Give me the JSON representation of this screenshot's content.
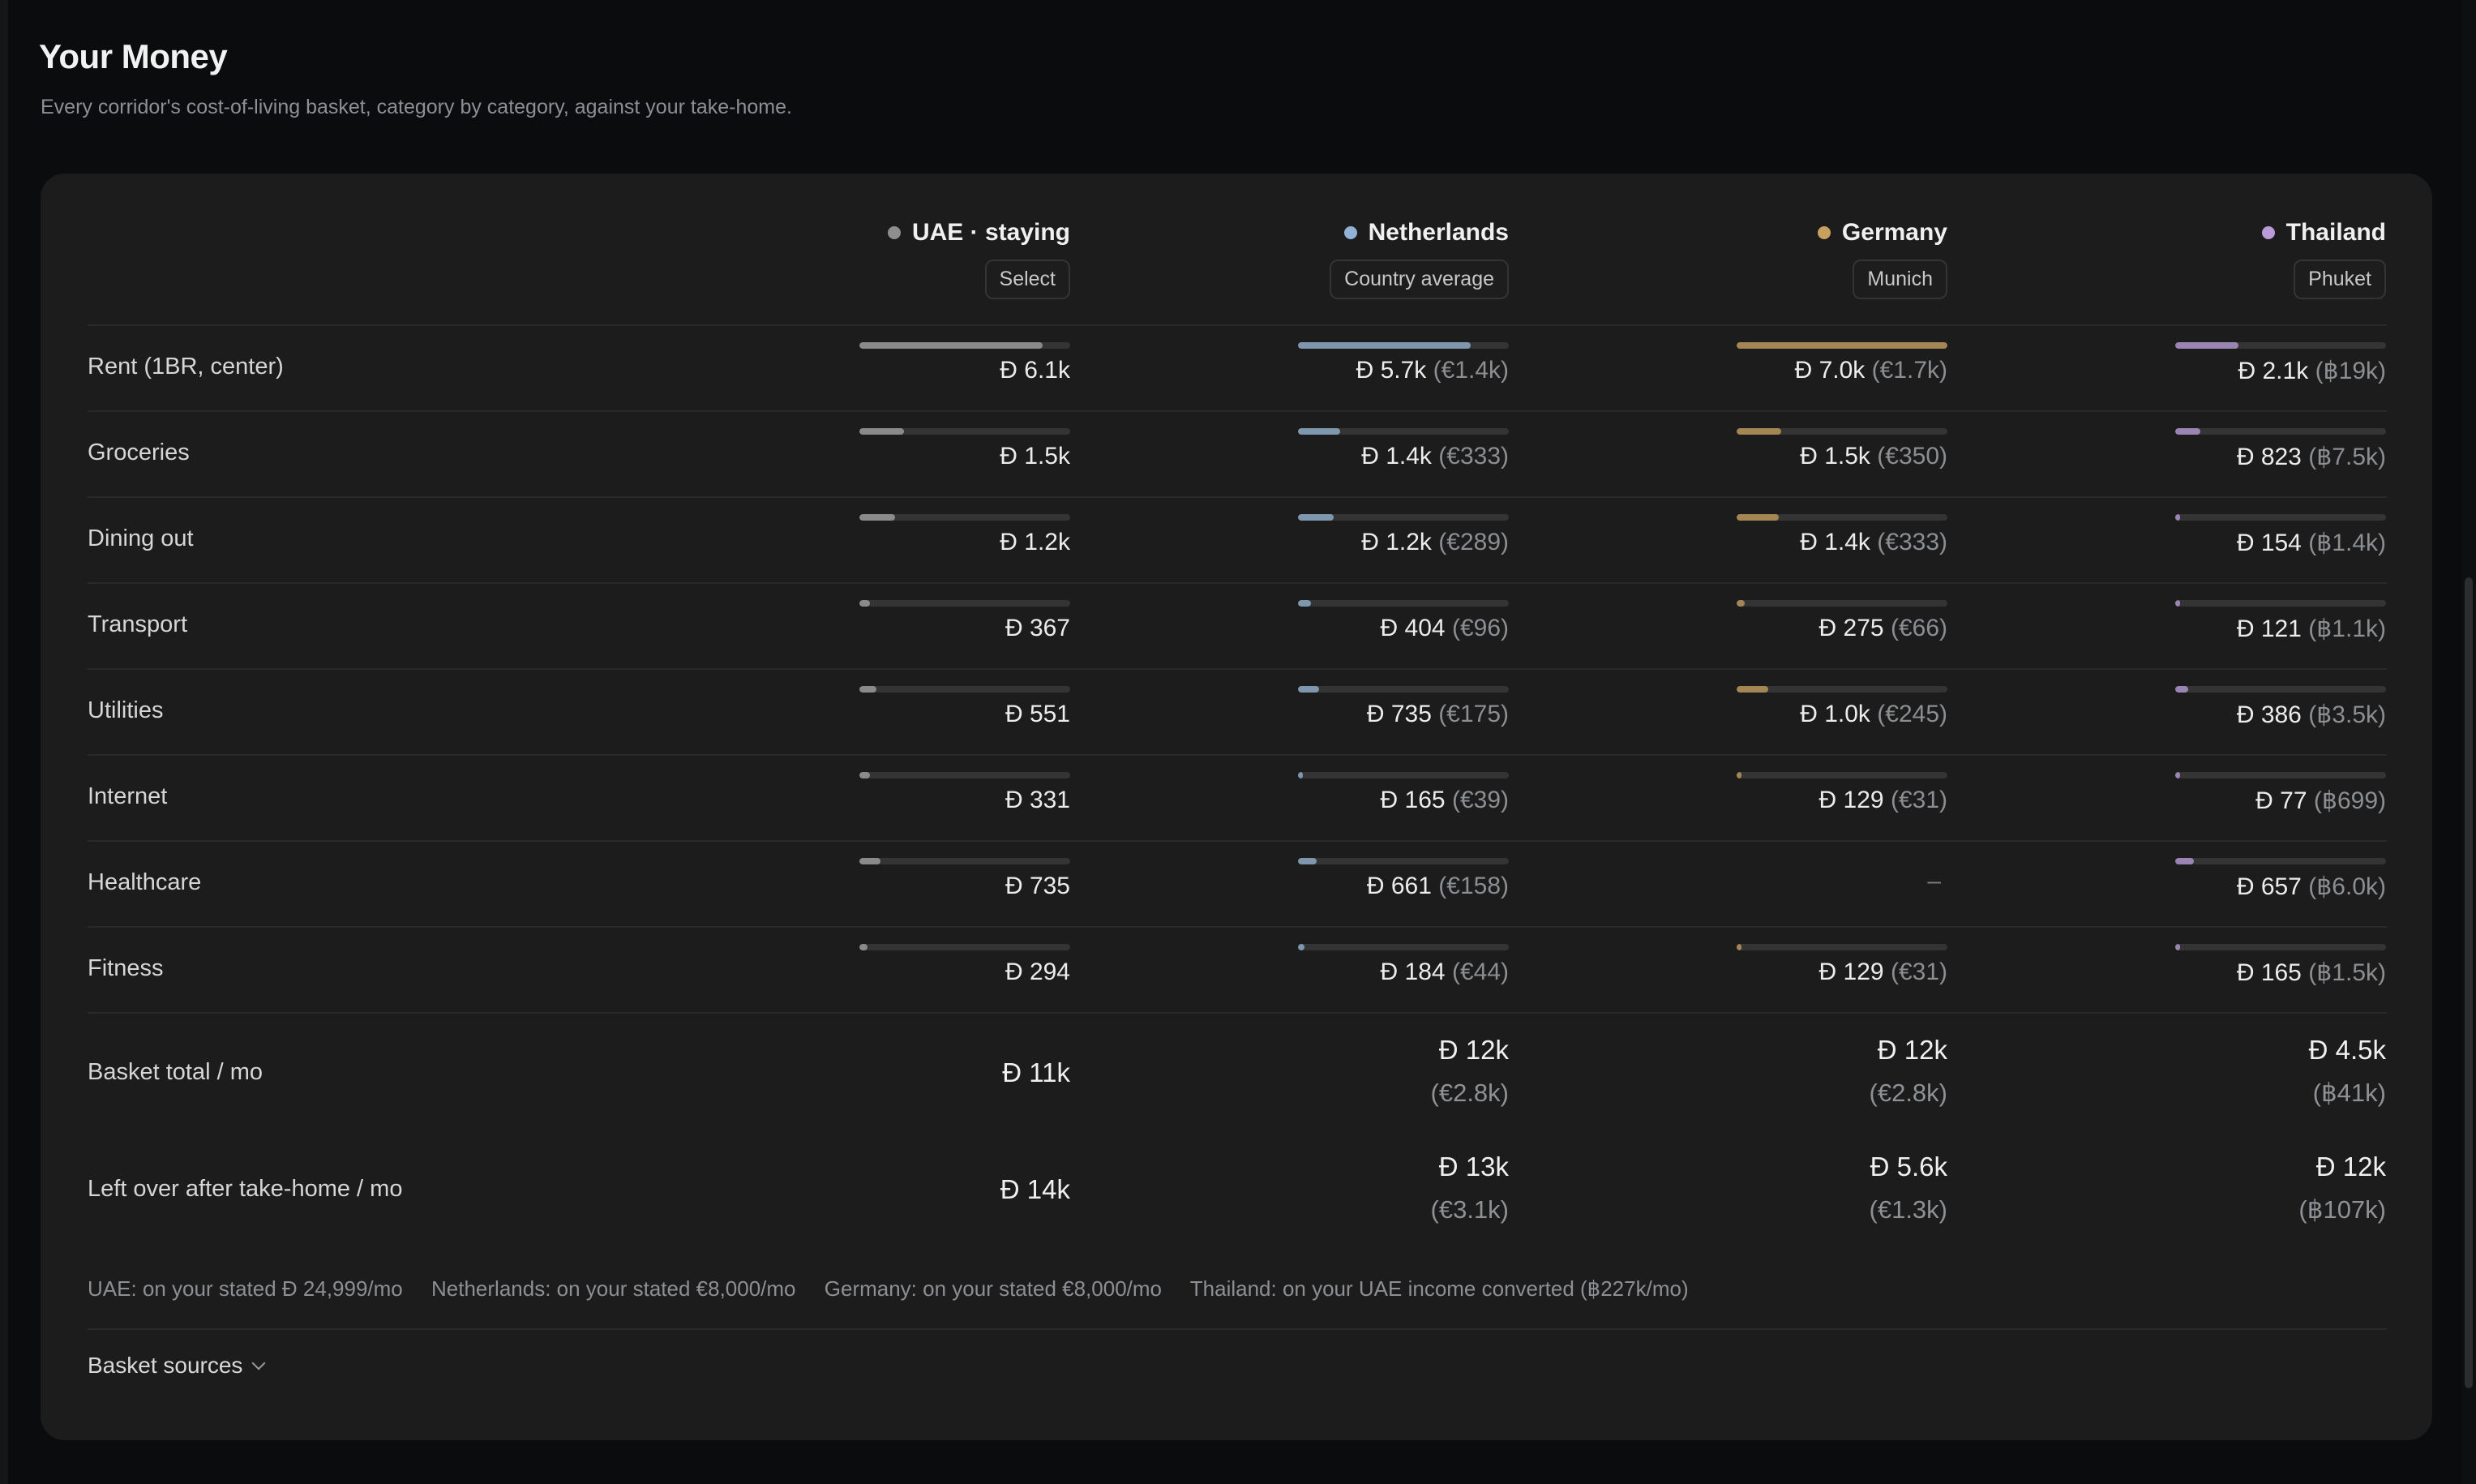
{
  "page": {
    "title": "Your Money",
    "subtitle": "Every corridor's cost-of-living basket, category by category, against your take-home."
  },
  "columns": [
    {
      "name": "UAE · staying",
      "selector": "Select",
      "dot_color": "#8e8e8e",
      "bar_color": "#8a8a8a"
    },
    {
      "name": "Netherlands",
      "selector": "Country average",
      "dot_color": "#8fb2d6",
      "bar_color": "#7f97ad"
    },
    {
      "name": "Germany",
      "selector": "Munich",
      "dot_color": "#c9a15e",
      "bar_color": "#a48654"
    },
    {
      "name": "Thailand",
      "selector": "Phuket",
      "dot_color": "#b99bd8",
      "bar_color": "#9a84b3"
    }
  ],
  "rows": [
    {
      "label": "Rent (1BR, center)",
      "cells": [
        {
          "value": "Ɖ 6.1k",
          "converted": "",
          "fraction": 0.87
        },
        {
          "value": "Ɖ 5.7k",
          "converted": "(€1.4k)",
          "fraction": 0.82
        },
        {
          "value": "Ɖ 7.0k",
          "converted": "(€1.7k)",
          "fraction": 1.0
        },
        {
          "value": "Ɖ 2.1k",
          "converted": "(฿19k)",
          "fraction": 0.3
        }
      ]
    },
    {
      "label": "Groceries",
      "cells": [
        {
          "value": "Ɖ 1.5k",
          "converted": "",
          "fraction": 0.21
        },
        {
          "value": "Ɖ 1.4k",
          "converted": "(€333)",
          "fraction": 0.2
        },
        {
          "value": "Ɖ 1.5k",
          "converted": "(€350)",
          "fraction": 0.21
        },
        {
          "value": "Ɖ 823",
          "converted": "(฿7.5k)",
          "fraction": 0.12
        }
      ]
    },
    {
      "label": "Dining out",
      "cells": [
        {
          "value": "Ɖ 1.2k",
          "converted": "",
          "fraction": 0.17
        },
        {
          "value": "Ɖ 1.2k",
          "converted": "(€289)",
          "fraction": 0.17
        },
        {
          "value": "Ɖ 1.4k",
          "converted": "(€333)",
          "fraction": 0.2
        },
        {
          "value": "Ɖ 154",
          "converted": "(฿1.4k)",
          "fraction": 0.02
        }
      ]
    },
    {
      "label": "Transport",
      "cells": [
        {
          "value": "Ɖ 367",
          "converted": "",
          "fraction": 0.05
        },
        {
          "value": "Ɖ 404",
          "converted": "(€96)",
          "fraction": 0.06
        },
        {
          "value": "Ɖ 275",
          "converted": "(€66)",
          "fraction": 0.04
        },
        {
          "value": "Ɖ 121",
          "converted": "(฿1.1k)",
          "fraction": 0.02
        }
      ]
    },
    {
      "label": "Utilities",
      "cells": [
        {
          "value": "Ɖ 551",
          "converted": "",
          "fraction": 0.08
        },
        {
          "value": "Ɖ 735",
          "converted": "(€175)",
          "fraction": 0.1
        },
        {
          "value": "Ɖ 1.0k",
          "converted": "(€245)",
          "fraction": 0.15
        },
        {
          "value": "Ɖ 386",
          "converted": "(฿3.5k)",
          "fraction": 0.06
        }
      ]
    },
    {
      "label": "Internet",
      "cells": [
        {
          "value": "Ɖ 331",
          "converted": "",
          "fraction": 0.05
        },
        {
          "value": "Ɖ 165",
          "converted": "(€39)",
          "fraction": 0.02
        },
        {
          "value": "Ɖ 129",
          "converted": "(€31)",
          "fraction": 0.02
        },
        {
          "value": "Ɖ 77",
          "converted": "(฿699)",
          "fraction": 0.01
        }
      ]
    },
    {
      "label": "Healthcare",
      "cells": [
        {
          "value": "Ɖ 735",
          "converted": "",
          "fraction": 0.1
        },
        {
          "value": "Ɖ 661",
          "converted": "(€158)",
          "fraction": 0.09
        },
        {
          "value": "–",
          "converted": "",
          "fraction": 0
        },
        {
          "value": "Ɖ 657",
          "converted": "(฿6.0k)",
          "fraction": 0.09
        }
      ]
    },
    {
      "label": "Fitness",
      "cells": [
        {
          "value": "Ɖ 294",
          "converted": "",
          "fraction": 0.04
        },
        {
          "value": "Ɖ 184",
          "converted": "(€44)",
          "fraction": 0.03
        },
        {
          "value": "Ɖ 129",
          "converted": "(€31)",
          "fraction": 0.02
        },
        {
          "value": "Ɖ 165",
          "converted": "(฿1.5k)",
          "fraction": 0.02
        }
      ]
    }
  ],
  "totals": [
    {
      "label": "Basket total / mo",
      "cells": [
        {
          "value": "Ɖ 11k",
          "converted": ""
        },
        {
          "value": "Ɖ 12k",
          "converted": "(€2.8k)"
        },
        {
          "value": "Ɖ 12k",
          "converted": "(€2.8k)"
        },
        {
          "value": "Ɖ 4.5k",
          "converted": "(฿41k)"
        }
      ]
    },
    {
      "label": "Left over after take-home / mo",
      "cells": [
        {
          "value": "Ɖ 14k",
          "converted": ""
        },
        {
          "value": "Ɖ 13k",
          "converted": "(€3.1k)"
        },
        {
          "value": "Ɖ 5.6k",
          "converted": "(€1.3k)"
        },
        {
          "value": "Ɖ 12k",
          "converted": "(฿107k)"
        }
      ]
    }
  ],
  "footnotes": [
    "UAE: on your stated Ɖ 24,999/mo",
    "Netherlands: on your stated €8,000/mo",
    "Germany: on your stated €8,000/mo",
    "Thailand: on your UAE income converted (฿227k/mo)"
  ],
  "sources": {
    "label": "Basket sources",
    "icon": "chevron-down-icon"
  }
}
